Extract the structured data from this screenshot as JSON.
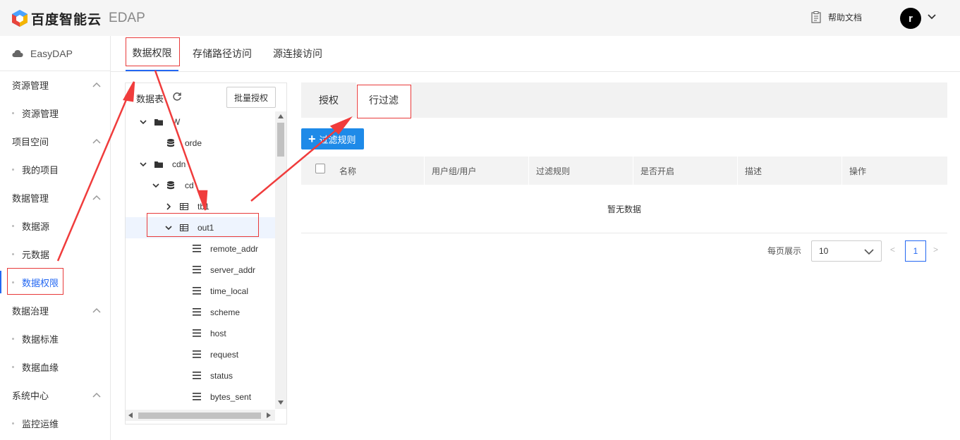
{
  "header": {
    "brand": "百度智能云",
    "product": "EDAP",
    "help_label": "帮助文档",
    "avatar_letter": "r"
  },
  "sidebar": {
    "app_name": "EasyDAP",
    "groups": [
      {
        "label": "资源管理",
        "items": [
          "资源管理"
        ]
      },
      {
        "label": "项目空间",
        "items": [
          "我的项目"
        ]
      },
      {
        "label": "数据管理",
        "items": [
          "数据源",
          "元数据",
          "数据权限"
        ]
      },
      {
        "label": "数据治理",
        "items": [
          "数据标准",
          "数据血缘"
        ]
      },
      {
        "label": "系统中心",
        "items": [
          "监控运维"
        ]
      }
    ],
    "active_item": "数据权限"
  },
  "main_tabs": [
    "数据权限",
    "存储路径访问",
    "源连接访问"
  ],
  "tree": {
    "title": "数据表",
    "batch_button": "批量授权",
    "nodes": [
      "W",
      "orde",
      "cdn",
      "cd",
      "tb1",
      "out1",
      "remote_addr",
      "server_addr",
      "time_local",
      "scheme",
      "host",
      "request",
      "status",
      "bytes_sent"
    ]
  },
  "sub_tabs": [
    "授权",
    "行过滤"
  ],
  "add_button": "过滤规则",
  "table": {
    "columns": [
      "名称",
      "用户组/用户",
      "过滤规则",
      "是否开启",
      "描述",
      "操作"
    ],
    "empty_text": "暂无数据"
  },
  "pagination": {
    "label": "每页展示",
    "page_size": "10",
    "prev": "<",
    "current": "1",
    "next": ">"
  },
  "colors": {
    "primary": "#2468f2",
    "button_blue": "#1e8ae8",
    "annotation_red": "#e83a3a"
  }
}
